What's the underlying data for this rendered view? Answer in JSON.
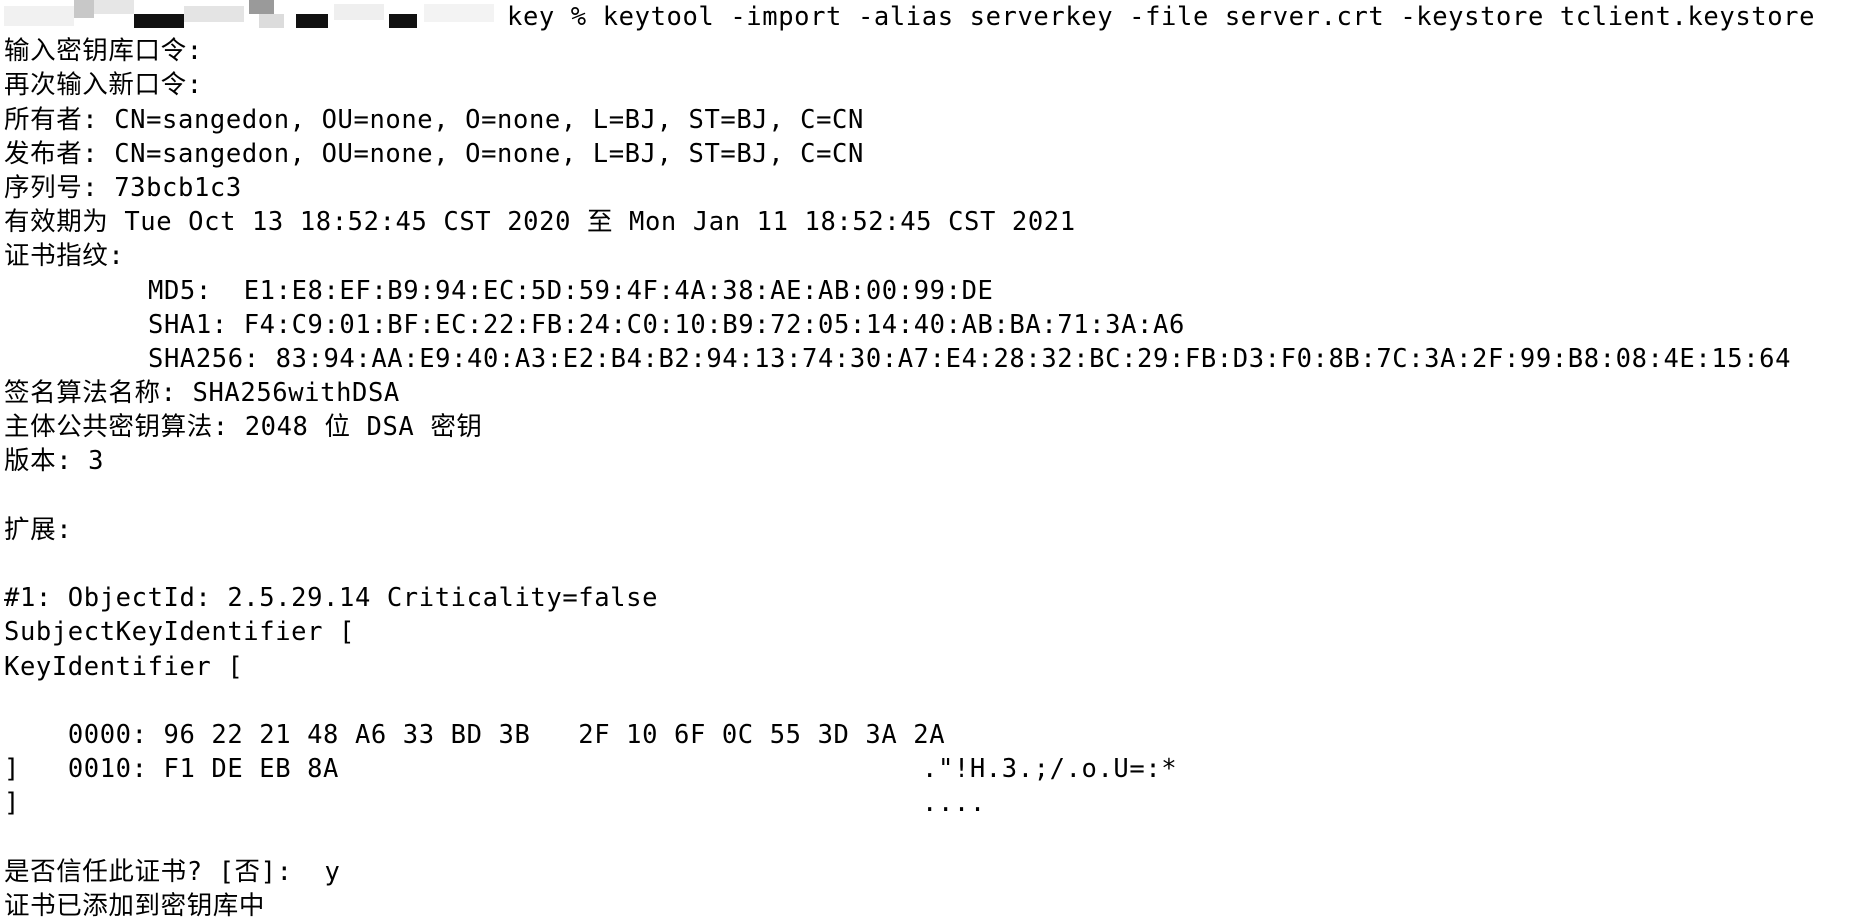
{
  "terminal": {
    "prompt_command": "key % keytool -import -alias serverkey -file server.crt -keystore tclient.keystore",
    "lines": {
      "l02": "输入密钥库口令:",
      "l03": "再次输入新口令:",
      "l04": "所有者: CN=sangedon, OU=none, O=none, L=BJ, ST=BJ, C=CN",
      "l05": "发布者: CN=sangedon, OU=none, O=none, L=BJ, ST=BJ, C=CN",
      "l06": "序列号: 73bcb1c3",
      "l07": "有效期为 Tue Oct 13 18:52:45 CST 2020 至 Mon Jan 11 18:52:45 CST 2021",
      "l08": "证书指纹:",
      "l09": "MD5:  E1:E8:EF:B9:94:EC:5D:59:4F:4A:38:AE:AB:00:99:DE",
      "l10": "SHA1: F4:C9:01:BF:EC:22:FB:24:C0:10:B9:72:05:14:40:AB:BA:71:3A:A6",
      "l11": "SHA256: 83:94:AA:E9:40:A3:E2:B4:B2:94:13:74:30:A7:E4:28:32:BC:29:FB:D3:F0:8B:7C:3A:2F:99:B8:08:4E:15:64",
      "l12": "签名算法名称: SHA256withDSA",
      "l13": "主体公共密钥算法: 2048 位 DSA 密钥",
      "l14": "版本: 3",
      "l16": "扩展:",
      "l18": "#1: ObjectId: 2.5.29.14 Criticality=false",
      "l19": "SubjectKeyIdentifier [",
      "l20": "KeyIdentifier [",
      "l21_hex": "0000: 96 22 21 48 A6 33 BD 3B   2F 10 6F 0C 55 3D 3A 2A",
      "l21_ascii": ".\"!H.3.;/.o.U=:*",
      "l22_hex": "0010: F1 DE EB 8A",
      "l22_ascii": "....",
      "l23": "]",
      "l24": "]",
      "l26": "是否信任此证书? [否]:  y",
      "l27": "证书已添加到密钥库中"
    }
  },
  "colors": {
    "background": "#ffffff",
    "text": "#000000",
    "redaction_light": "#e9e9e9",
    "redaction_mid": "#c4c4c4",
    "redaction_dark": "#111111"
  }
}
